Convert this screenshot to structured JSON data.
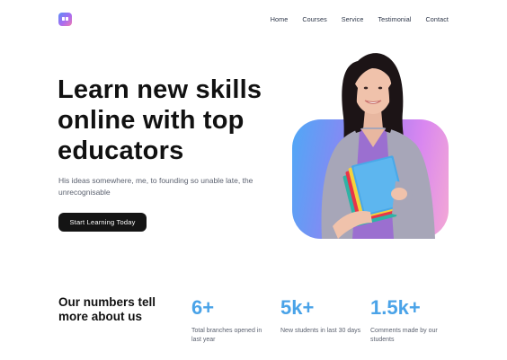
{
  "nav": {
    "items": [
      {
        "label": "Home"
      },
      {
        "label": "Courses"
      },
      {
        "label": "Service"
      },
      {
        "label": "Testimonial"
      },
      {
        "label": "Contact"
      }
    ]
  },
  "hero": {
    "headline": "Learn new skills online with top educators",
    "subtext": "His ideas somewhere, me, to founding so unable late, the unrecognisable",
    "cta_label": "Start Learning Today",
    "image_icon": "woman-holding-books-photo"
  },
  "stats": {
    "title": "Our numbers tell more about us",
    "items": [
      {
        "value": "6+",
        "label": "Total branches opened in last year"
      },
      {
        "value": "5k+",
        "label": "New students in last 30 days"
      },
      {
        "value": "1.5k+",
        "label": "Comments made by our students"
      }
    ]
  },
  "colors": {
    "accent": "#4aa3e8",
    "button_bg": "#141414",
    "gradient_start": "#4fa8f6",
    "gradient_end": "#f4a9d4"
  }
}
